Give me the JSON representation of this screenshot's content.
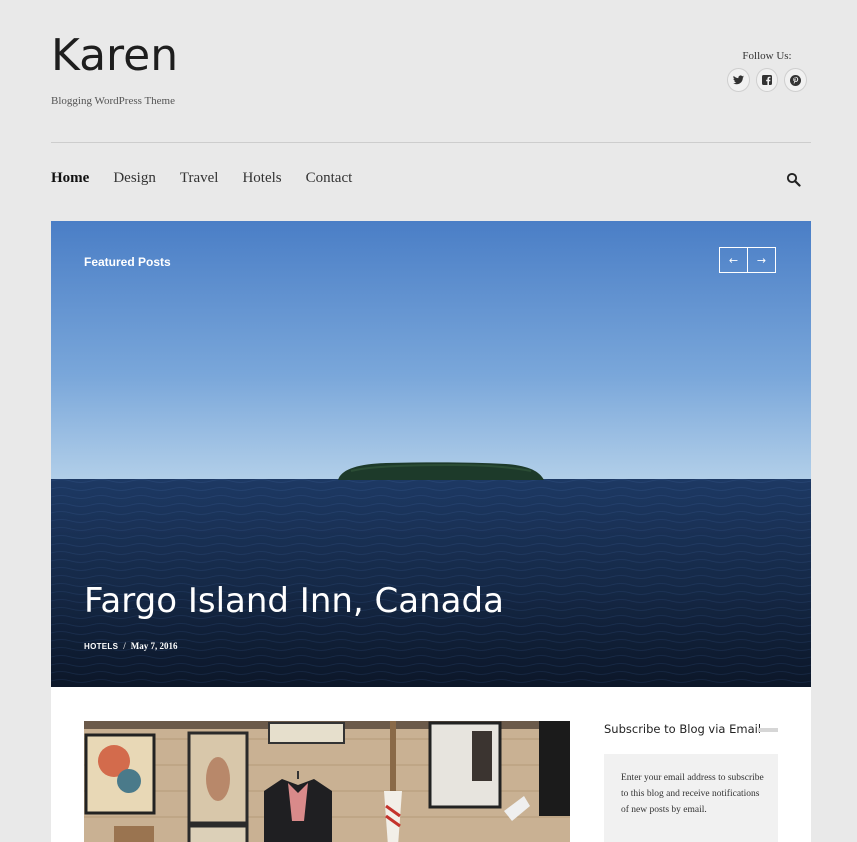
{
  "site": {
    "title": "Karen",
    "tagline": "Blogging WordPress Theme"
  },
  "follow": {
    "label": "Follow Us:",
    "icons": [
      "twitter-icon",
      "facebook-icon",
      "pinterest-icon"
    ]
  },
  "nav": {
    "items": [
      {
        "label": "Home",
        "active": true
      },
      {
        "label": "Design"
      },
      {
        "label": "Travel"
      },
      {
        "label": "Hotels"
      },
      {
        "label": "Contact"
      }
    ],
    "search_icon": "search-icon"
  },
  "hero": {
    "section_label": "Featured Posts",
    "prev_icon": "←",
    "next_icon": "→",
    "post_title": "Fargo Island Inn, Canada",
    "category": "HOTELS",
    "separator": "/",
    "date": "May 7, 2016"
  },
  "sidebar": {
    "widget_title": "Subscribe to Blog via Email",
    "widget_text": "Enter your email address to subscribe to this blog and receive notifications of new posts by email."
  },
  "colors": {
    "page_bg": "#e9e9e9",
    "sky_top": "#4b7fc7",
    "sky_bottom": "#a7c7e6",
    "sea": "#1f3c68",
    "content_bg": "#ffffff"
  }
}
